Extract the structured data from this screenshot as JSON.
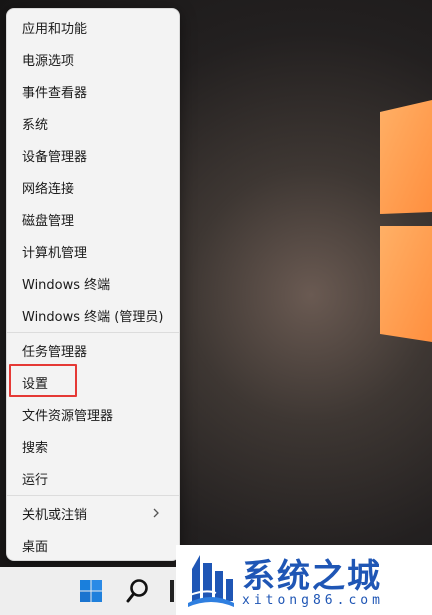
{
  "menu": {
    "items": [
      {
        "label": "应用和功能"
      },
      {
        "label": "电源选项"
      },
      {
        "label": "事件查看器"
      },
      {
        "label": "系统"
      },
      {
        "label": "设备管理器"
      },
      {
        "label": "网络连接"
      },
      {
        "label": "磁盘管理"
      },
      {
        "label": "计算机管理"
      },
      {
        "label": "Windows 终端"
      },
      {
        "label": "Windows 终端 (管理员)"
      },
      {
        "label": "任务管理器"
      },
      {
        "label": "设置",
        "highlighted": true,
        "highlight_color": "#e53935"
      },
      {
        "label": "文件资源管理器"
      },
      {
        "label": "搜索"
      },
      {
        "label": "运行"
      },
      {
        "label": "关机或注销",
        "submenu": true,
        "icon": "chevron-right-icon"
      },
      {
        "label": "桌面"
      }
    ]
  },
  "taskbar": {
    "icons": [
      "windows-start-icon",
      "search-icon",
      "edge-icon"
    ]
  },
  "watermark": {
    "title": "系统之城",
    "subtitle": "xitong86.com",
    "color": "#1f56b5"
  },
  "wallpaper": {
    "accent_color": "#ff9a4a"
  }
}
